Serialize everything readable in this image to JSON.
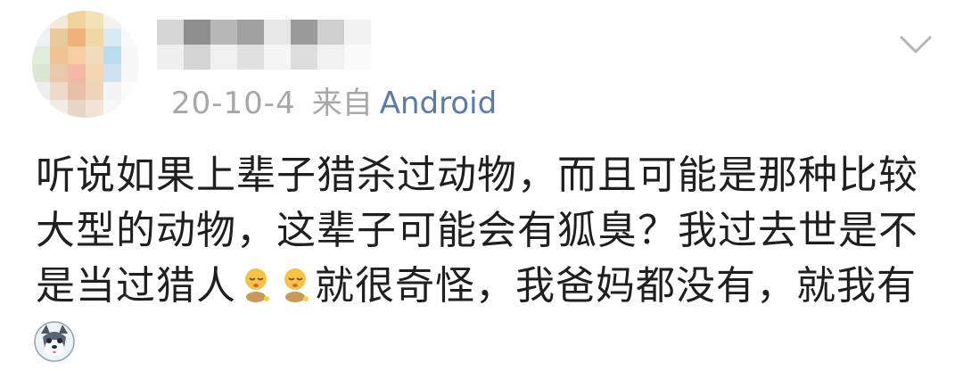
{
  "author": {
    "name_redacted": true,
    "date": "20-10-4",
    "source_prefix": "来自",
    "platform": "Android"
  },
  "post": {
    "lines": [
      "听说如果上辈子猎杀过动物，而且可能是那种比较",
      "大型的动物，这辈子可能会有狐臭？我过去世是不"
    ],
    "line3_before_emoji": "是当过猎人",
    "line3_after_emoji": "就很奇怪，我爸妈都没有，就我有"
  },
  "icons": {
    "expand": "chevron-down-icon",
    "emoji": "sleepy-baby-emoji",
    "sticker": "husky-sticker"
  },
  "colors": {
    "meta_gray": "#a7a7a7",
    "platform_blue": "#5b7aa8",
    "text": "#1f1f1f"
  }
}
